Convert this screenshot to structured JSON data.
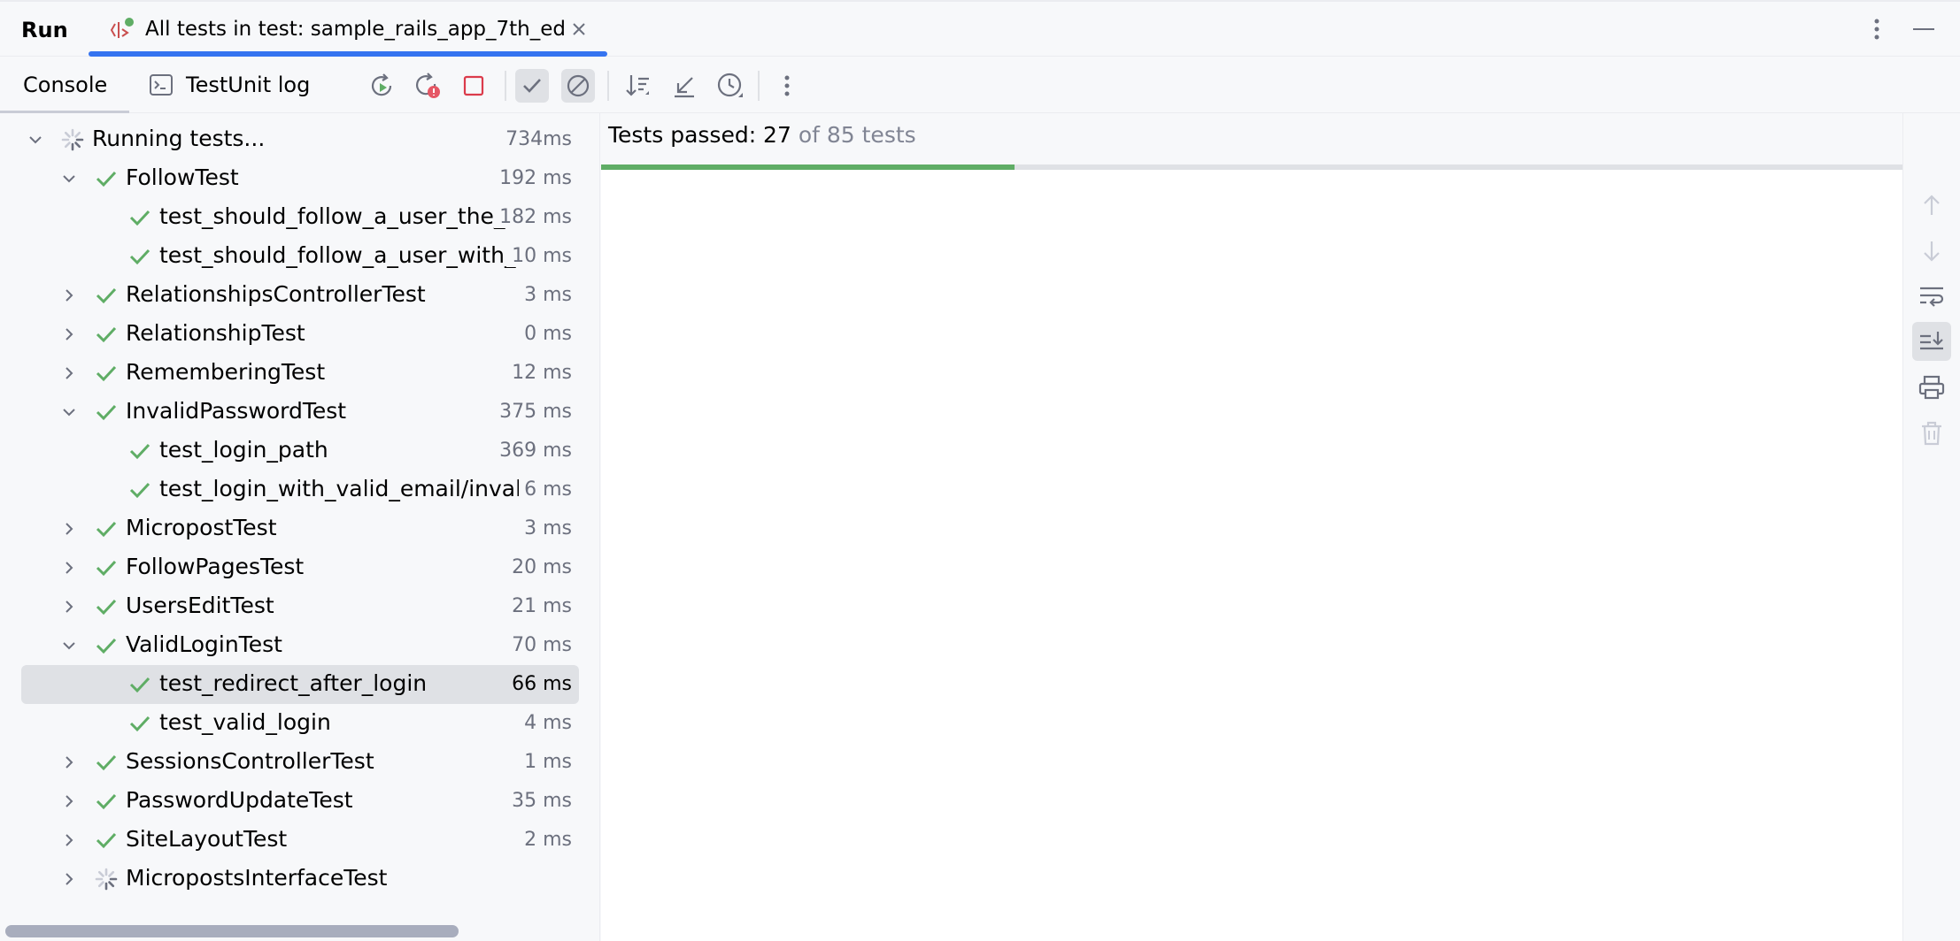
{
  "window": {
    "run_label": "Run",
    "tab_title": "All tests in test: sample_rails_app_7th_ed",
    "accent_color": "#3574f0"
  },
  "toolbar": {
    "console_tab": "Console",
    "testunit_log_tab": "TestUnit log",
    "buttons": [
      "rerun-icon",
      "rerun-failed-icon",
      "stop-icon",
      "show-passed-icon",
      "show-ignored-icon",
      "sort-icon",
      "collapse-icon",
      "history-icon",
      "more-icon"
    ]
  },
  "summary": {
    "passed_text": "Tests passed: 27",
    "total_text": "of 85 tests",
    "passed": 27,
    "total": 85,
    "progress_color": "#5fad65"
  },
  "tree": {
    "rows": [
      {
        "name": "Running tests...",
        "duration": "734ms",
        "level": 0,
        "expand": "down",
        "status": "running"
      },
      {
        "name": "FollowTest",
        "duration": "192 ms",
        "level": 1,
        "expand": "down",
        "status": "passed"
      },
      {
        "name": "test_should_follow_a_user_the_",
        "duration": "182 ms",
        "level": 2,
        "expand": "none",
        "status": "passed"
      },
      {
        "name": "test_should_follow_a_user_with_",
        "duration": "10 ms",
        "level": 2,
        "expand": "none",
        "status": "passed"
      },
      {
        "name": "RelationshipsControllerTest",
        "duration": "3 ms",
        "level": 1,
        "expand": "right",
        "status": "passed"
      },
      {
        "name": "RelationshipTest",
        "duration": "0 ms",
        "level": 1,
        "expand": "right",
        "status": "passed"
      },
      {
        "name": "RememberingTest",
        "duration": "12 ms",
        "level": 1,
        "expand": "right",
        "status": "passed"
      },
      {
        "name": "InvalidPasswordTest",
        "duration": "375 ms",
        "level": 1,
        "expand": "down",
        "status": "passed"
      },
      {
        "name": "test_login_path",
        "duration": "369 ms",
        "level": 2,
        "expand": "none",
        "status": "passed"
      },
      {
        "name": "test_login_with_valid_email/invalid",
        "duration": "6 ms",
        "level": 2,
        "expand": "none",
        "status": "passed"
      },
      {
        "name": "MicropostTest",
        "duration": "3 ms",
        "level": 1,
        "expand": "right",
        "status": "passed"
      },
      {
        "name": "FollowPagesTest",
        "duration": "20 ms",
        "level": 1,
        "expand": "right",
        "status": "passed"
      },
      {
        "name": "UsersEditTest",
        "duration": "21 ms",
        "level": 1,
        "expand": "right",
        "status": "passed"
      },
      {
        "name": "ValidLoginTest",
        "duration": "70 ms",
        "level": 1,
        "expand": "down",
        "status": "passed"
      },
      {
        "name": "test_redirect_after_login",
        "duration": "66 ms",
        "level": 2,
        "expand": "none",
        "status": "passed",
        "selected": true
      },
      {
        "name": "test_valid_login",
        "duration": "4 ms",
        "level": 2,
        "expand": "none",
        "status": "passed"
      },
      {
        "name": "SessionsControllerTest",
        "duration": "1 ms",
        "level": 1,
        "expand": "right",
        "status": "passed"
      },
      {
        "name": "PasswordUpdateTest",
        "duration": "35 ms",
        "level": 1,
        "expand": "right",
        "status": "passed"
      },
      {
        "name": "SiteLayoutTest",
        "duration": "2 ms",
        "level": 1,
        "expand": "right",
        "status": "passed"
      },
      {
        "name": "MicropostsInterfaceTest",
        "duration": "",
        "level": 1,
        "expand": "right",
        "status": "running"
      }
    ]
  },
  "right_strip": {
    "buttons": [
      "arrow-up-icon",
      "arrow-down-icon",
      "soft-wrap-icon",
      "scroll-to-end-icon",
      "print-icon",
      "trash-icon"
    ]
  }
}
